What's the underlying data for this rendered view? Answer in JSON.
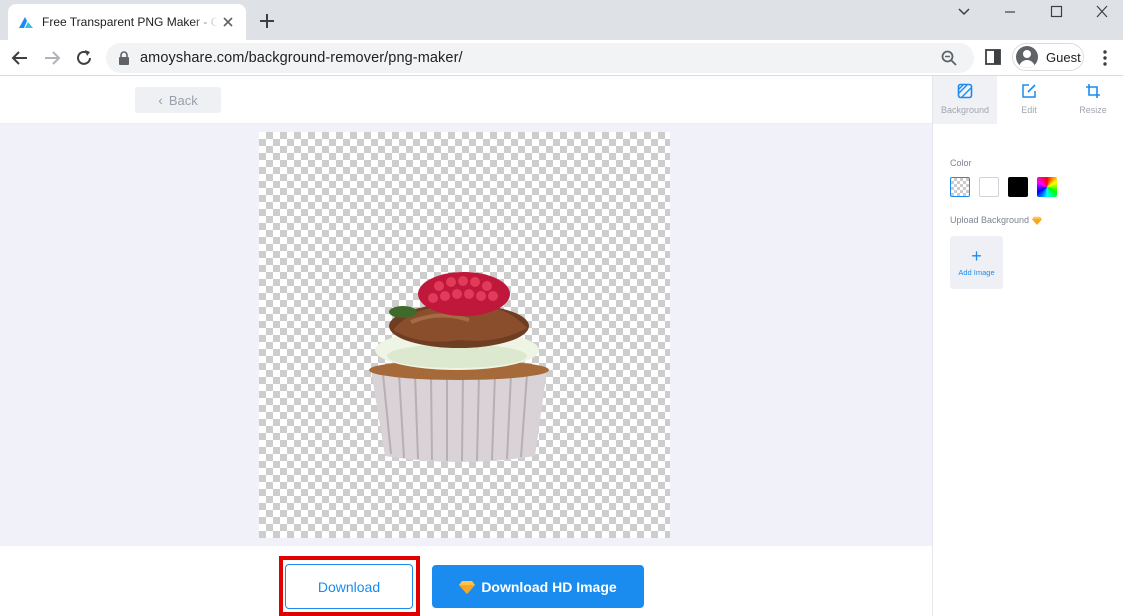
{
  "browser": {
    "tab_title": "Free Transparent PNG Maker - Create",
    "url": "amoyshare.com/background-remover/png-maker/",
    "profile_label": "Guest"
  },
  "page": {
    "back_label": "Back",
    "download_label": "Download",
    "download_hd_label": "Download HD Image"
  },
  "sidebar": {
    "tabs": [
      {
        "label": "Background",
        "icon": "background-icon",
        "active": true
      },
      {
        "label": "Edit",
        "icon": "edit-icon",
        "active": false
      },
      {
        "label": "Resize",
        "icon": "crop-icon",
        "active": false
      }
    ],
    "color_label": "Color",
    "swatches": [
      "transparent",
      "#ffffff",
      "#000000",
      "rainbow"
    ],
    "upload_label": "Upload Background",
    "add_image_label": "Add Image"
  },
  "colors": {
    "accent": "#1a8cf0",
    "highlight": "#e00000",
    "canvas_bg": "#f0f1f9"
  }
}
